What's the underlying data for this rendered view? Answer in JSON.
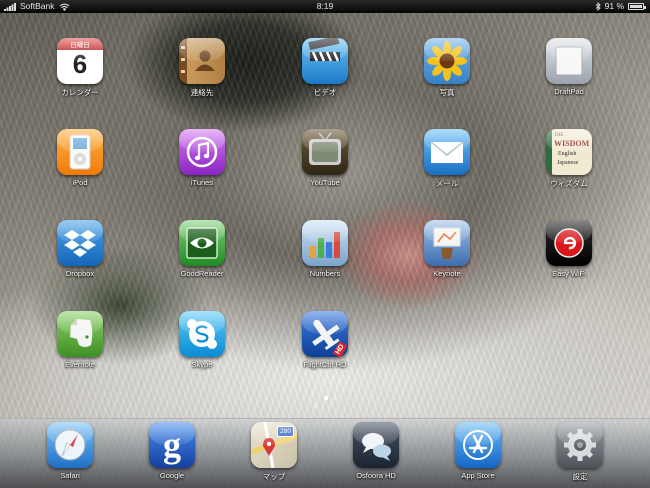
{
  "status_bar": {
    "carrier": "SoftBank",
    "time": "8:19",
    "battery_percent": "91 %"
  },
  "apps": [
    {
      "name": "calendar",
      "label": "カレンダー",
      "icon": "calendar-icon",
      "day": "日曜日",
      "date": "6"
    },
    {
      "name": "contacts",
      "label": "連絡先",
      "icon": "contacts-icon"
    },
    {
      "name": "video",
      "label": "ビデオ",
      "icon": "video-clapper-icon"
    },
    {
      "name": "photos",
      "label": "写真",
      "icon": "sunflower-icon"
    },
    {
      "name": "draftpad",
      "label": "DraftPad",
      "icon": "draftpad-icon"
    },
    {
      "name": "ipod",
      "label": "iPod",
      "icon": "ipod-icon"
    },
    {
      "name": "itunes",
      "label": "iTunes",
      "icon": "itunes-note-icon"
    },
    {
      "name": "youtube",
      "label": "YouTube",
      "icon": "youtube-tv-icon"
    },
    {
      "name": "mail",
      "label": "メール",
      "icon": "mail-envelope-icon"
    },
    {
      "name": "wisdom",
      "label": "ウィズダム",
      "icon": "wisdom-dictionary-icon",
      "icon_text": [
        "THE",
        "WISDOM",
        "English",
        "Japanese"
      ]
    },
    {
      "name": "dropbox",
      "label": "Dropbox",
      "icon": "dropbox-icon"
    },
    {
      "name": "goodreader",
      "label": "GoodReader",
      "icon": "goodreader-eye-icon"
    },
    {
      "name": "numbers",
      "label": "Numbers",
      "icon": "numbers-chart-icon"
    },
    {
      "name": "keynote",
      "label": "Keynote",
      "icon": "keynote-podium-icon"
    },
    {
      "name": "easywifi",
      "label": "Easy WiFi",
      "icon": "easywifi-icon"
    },
    {
      "name": "evernote",
      "label": "Evernote",
      "icon": "evernote-elephant-icon"
    },
    {
      "name": "skype",
      "label": "Skype",
      "icon": "skype-icon"
    },
    {
      "name": "flightctrl",
      "label": "FlightCtrl HD",
      "icon": "airplane-icon",
      "icon_badge": "HD"
    }
  ],
  "dock": [
    {
      "name": "safari",
      "label": "Safari",
      "icon": "safari-compass-icon"
    },
    {
      "name": "google",
      "label": "Google",
      "icon": "google-g-icon",
      "icon_text": "g"
    },
    {
      "name": "maps",
      "label": "マップ",
      "icon": "maps-icon",
      "icon_text": "280"
    },
    {
      "name": "osfoora",
      "label": "Osfoora HD",
      "icon": "osfoora-bubbles-icon"
    },
    {
      "name": "appstore",
      "label": "App Store",
      "icon": "appstore-icon"
    },
    {
      "name": "settings",
      "label": "設定",
      "icon": "settings-gear-icon"
    }
  ],
  "page_indicator": {
    "pages": 3,
    "current": 1
  }
}
